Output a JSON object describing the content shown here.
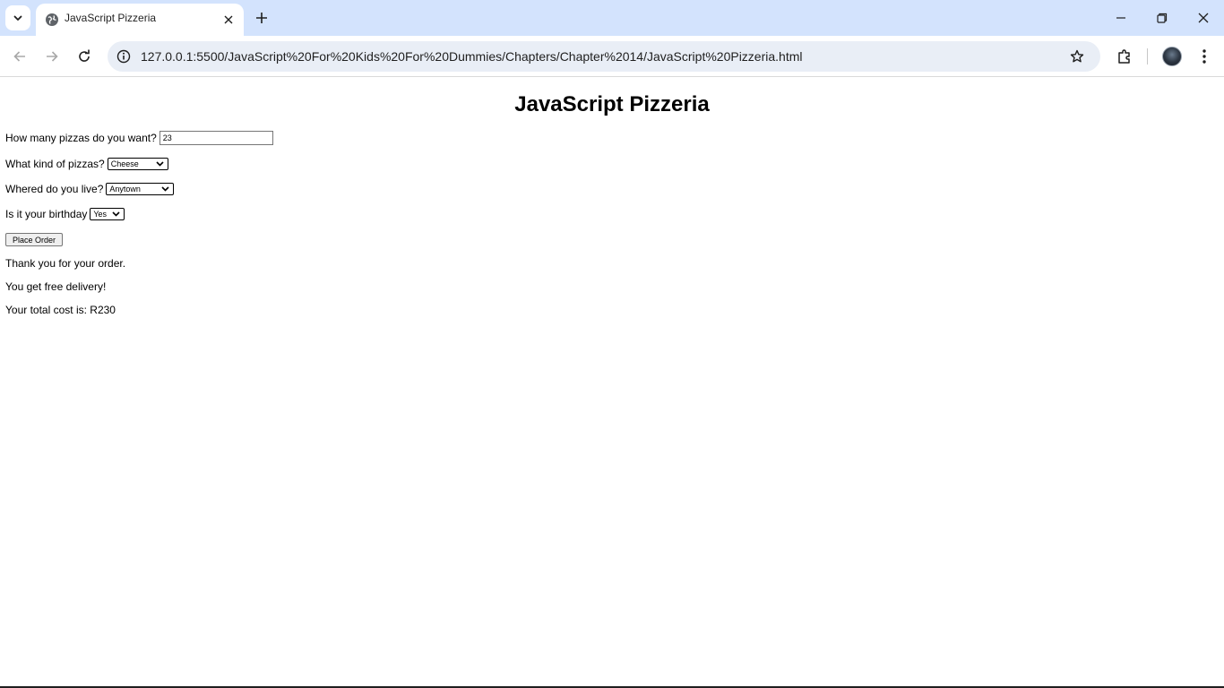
{
  "browser": {
    "tab_title": "JavaScript Pizzeria",
    "url": "127.0.0.1:5500/JavaScript%20For%20Kids%20For%20Dummies/Chapters/Chapter%2014/JavaScript%20Pizzeria.html",
    "icons": [
      "chevron-down-icon",
      "globe-icon",
      "close-icon",
      "plus-icon",
      "minimize-icon",
      "restore-icon",
      "close-window-icon",
      "back-icon",
      "forward-icon",
      "reload-icon",
      "site-info-icon",
      "star-icon",
      "puzzle-icon",
      "avatar",
      "kebab-menu-icon"
    ]
  },
  "page": {
    "title": "JavaScript Pizzeria",
    "quantity": {
      "label": "How many pizzas do you want?",
      "value": "23"
    },
    "kind": {
      "label": "What kind of pizzas?",
      "selected": "Cheese"
    },
    "location": {
      "label": "Whered do you live?",
      "selected": "Anytown"
    },
    "birthday": {
      "label": "Is it your birthday",
      "selected": "Yes"
    },
    "order_button": "Place Order",
    "messages": {
      "thanks": "Thank you for your order.",
      "delivery": "You get free delivery!",
      "total": "Your total cost is: R230"
    }
  }
}
